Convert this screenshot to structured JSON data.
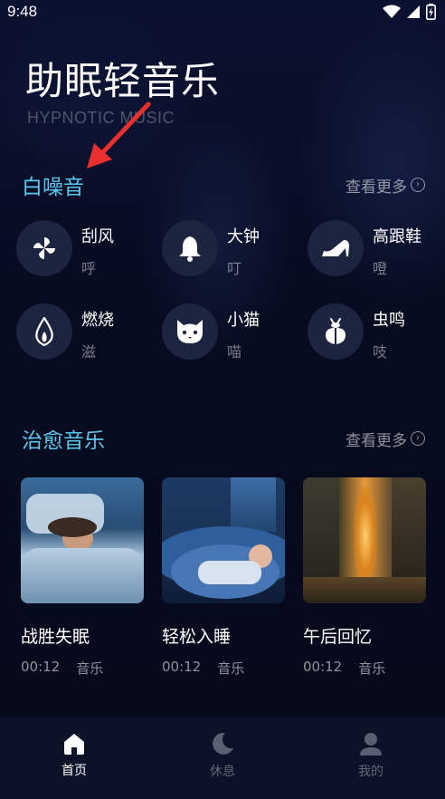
{
  "status": {
    "time": "9:48"
  },
  "app": {
    "title": "助眠轻音乐",
    "subtitle": "HYPNOTIC MUSIC"
  },
  "white_noise": {
    "title": "白噪音",
    "more": "查看更多",
    "items": [
      {
        "name": "刮风",
        "sub": "呼",
        "icon": "pinwheel-icon"
      },
      {
        "name": "大钟",
        "sub": "叮",
        "icon": "bell-icon"
      },
      {
        "name": "高跟鞋",
        "sub": "噔",
        "icon": "high-heel-icon"
      },
      {
        "name": "燃烧",
        "sub": "滋",
        "icon": "flame-icon"
      },
      {
        "name": "小猫",
        "sub": "喵",
        "icon": "cat-icon"
      },
      {
        "name": "虫鸣",
        "sub": "吱",
        "icon": "beetle-icon"
      }
    ]
  },
  "healing_music": {
    "title": "治愈音乐",
    "more": "查看更多",
    "items": [
      {
        "title": "战胜失眠",
        "duration": "00:12",
        "type": "音乐"
      },
      {
        "title": "轻松入睡",
        "duration": "00:12",
        "type": "音乐"
      },
      {
        "title": "午后回忆",
        "duration": "00:12",
        "type": "音乐"
      }
    ]
  },
  "tabs": [
    {
      "label": "首页",
      "icon": "home-icon",
      "active": true
    },
    {
      "label": "休息",
      "icon": "moon-icon",
      "active": false
    },
    {
      "label": "我的",
      "icon": "profile-icon",
      "active": false
    }
  ],
  "colors": {
    "accent": "#5bc8f0",
    "background": "#070b1c",
    "icon_circle": "#1c2440"
  }
}
